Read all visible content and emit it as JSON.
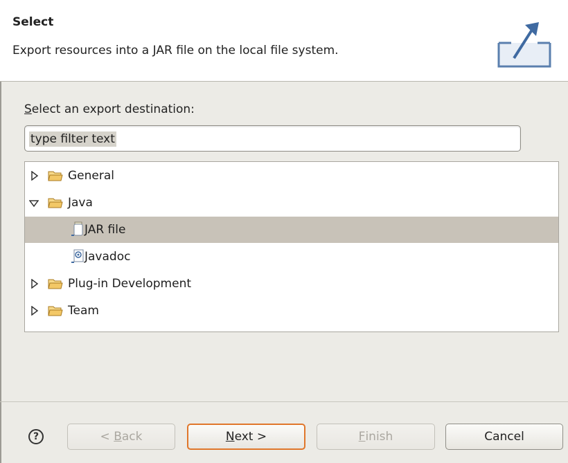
{
  "header": {
    "title": "Select",
    "description": "Export resources into a JAR file on the local file system.",
    "icon": "export-icon"
  },
  "destination_label": {
    "mnemonic": "S",
    "rest": "elect an export destination:"
  },
  "filter": {
    "value": "type filter text"
  },
  "tree": {
    "items": [
      {
        "label": "General",
        "expanded": false,
        "icon": "folder-icon"
      },
      {
        "label": "Java",
        "expanded": true,
        "icon": "folder-icon"
      },
      {
        "label": "JAR file",
        "icon": "jar-file-icon",
        "selected": true
      },
      {
        "label": "Javadoc",
        "icon": "javadoc-icon"
      },
      {
        "label": "Plug-in Development",
        "expanded": false,
        "icon": "folder-icon"
      },
      {
        "label": "Team",
        "expanded": false,
        "icon": "folder-icon"
      }
    ]
  },
  "buttons": {
    "help": "?",
    "back_prefix": "< ",
    "back_mnemonic": "B",
    "back_rest": "ack",
    "next_mnemonic": "N",
    "next_rest": "ext >",
    "finish_mnemonic": "F",
    "finish_rest": "inish",
    "cancel": "Cancel"
  },
  "colors": {
    "selection": "#c8c2b8",
    "default_button_border": "#e0762a",
    "folder_fill": "#f3c867"
  }
}
